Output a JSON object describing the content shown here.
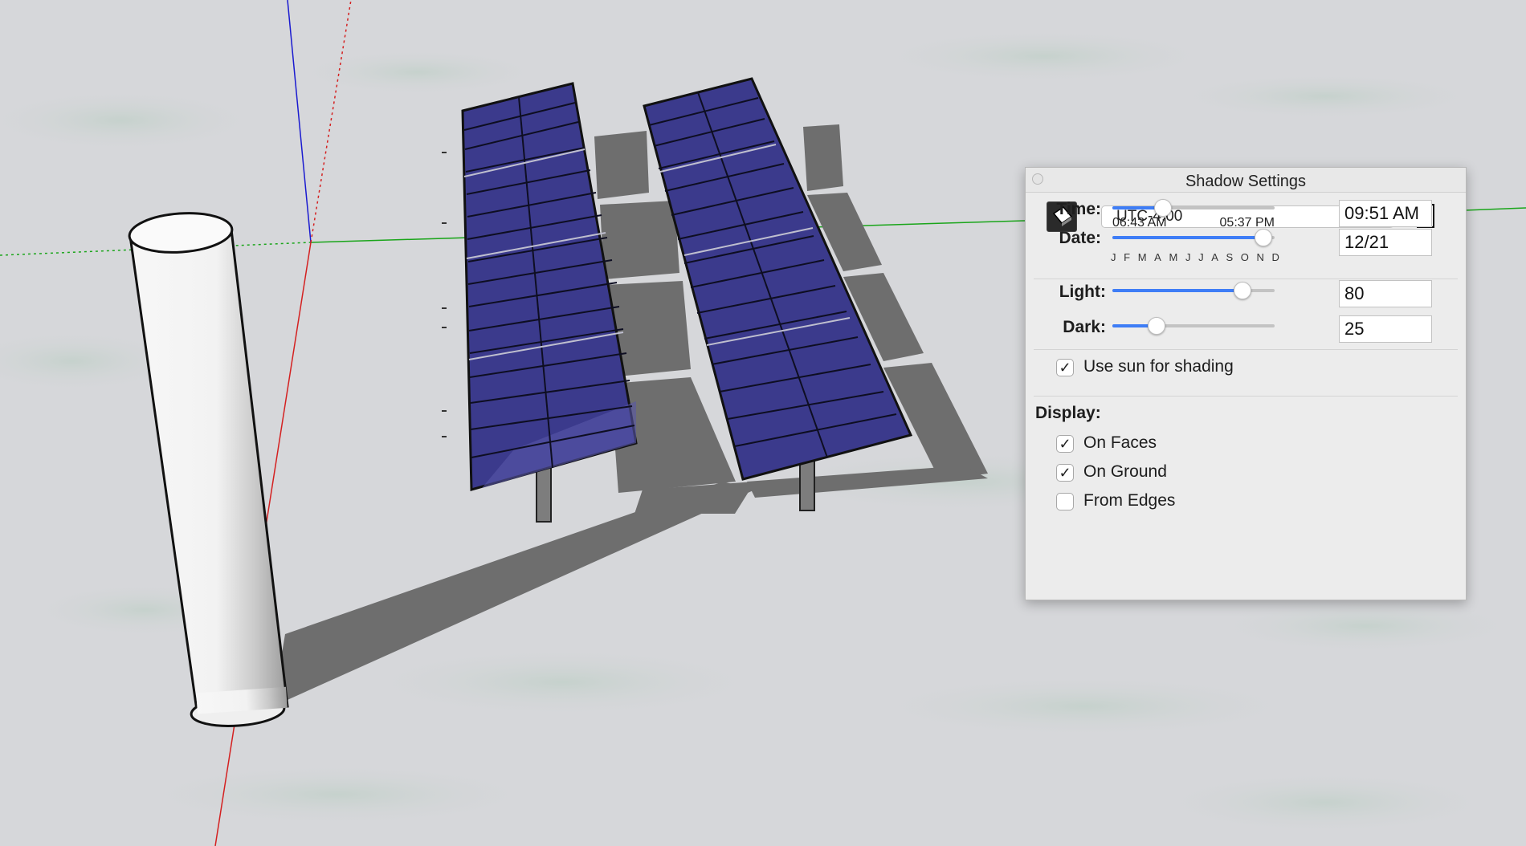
{
  "window": {
    "title": "Shadow Settings"
  },
  "timezone": {
    "selected": "UTC-4:00"
  },
  "time": {
    "label": "Time:",
    "range_start": "06:43 AM",
    "range_end": "05:37 PM",
    "value": "09:51 AM",
    "slider_fraction": 0.31
  },
  "date": {
    "label": "Date:",
    "months": [
      "J",
      "F",
      "M",
      "A",
      "M",
      "J",
      "J",
      "A",
      "S",
      "O",
      "N",
      "D"
    ],
    "value": "12/21",
    "slider_fraction": 0.93
  },
  "light": {
    "label": "Light:",
    "value": "80",
    "slider_fraction": 0.8
  },
  "dark": {
    "label": "Dark:",
    "value": "25",
    "slider_fraction": 0.27
  },
  "use_sun_shading": {
    "label": "Use sun for shading",
    "checked": true
  },
  "display": {
    "label": "Display:",
    "on_faces": {
      "label": "On Faces",
      "checked": true
    },
    "on_ground": {
      "label": "On Ground",
      "checked": true
    },
    "from_edges": {
      "label": "From Edges",
      "checked": false
    }
  },
  "icons": {
    "sun_toggle": "shadow-toggle-icon",
    "expand": "collapse-panel-icon",
    "close": "close-icon",
    "check": "checkmark-icon"
  },
  "colors": {
    "accent": "#3e7df6",
    "panel_blue": "#3b3a8c",
    "axis_red": "#d42020",
    "axis_green": "#1aa51a",
    "axis_blue": "#1a1ad0"
  }
}
